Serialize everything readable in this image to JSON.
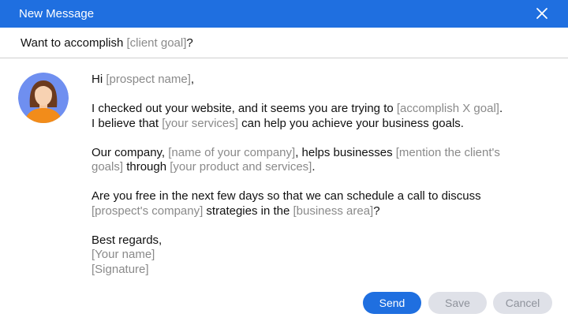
{
  "window": {
    "title": "New Message",
    "close_icon": "close-icon"
  },
  "subject": {
    "prefix": "Want to accomplish ",
    "placeholder": "[client goal]",
    "suffix": "?"
  },
  "avatar": {
    "icon": "user-avatar-icon"
  },
  "message": {
    "greeting": {
      "t1": "Hi ",
      "p1": "[prospect name]",
      "t2": ","
    },
    "para1": {
      "t1": "I checked out your website, and it seems you are trying to ",
      "p1": "[accomplish X goal]",
      "t2": ".\nI believe that ",
      "p2": "[your services]",
      "t3": " can help you achieve your business goals."
    },
    "para2": {
      "t1": "Our company, ",
      "p1": "[name of your company]",
      "t2": ", helps businesses ",
      "p2": "[mention the client's\ngoals]",
      "t3": " through ",
      "p3": "[your product and services]",
      "t4": "."
    },
    "para3": {
      "t1": "Are you free in the next few days so that we can schedule a call to discuss\n",
      "p1": "[prospect's company]",
      "t2": " strategies in the ",
      "p2": "[business area]",
      "t3": "?"
    },
    "signoff": {
      "t1": "Best regards,\n",
      "p1": "[Your name]",
      "t2": "\n",
      "p2": "[Signature]"
    }
  },
  "buttons": {
    "send": "Send",
    "save": "Save",
    "cancel": "Cancel"
  },
  "colors": {
    "accent": "#1f6fe0",
    "placeholder": "#8a8a8a",
    "disabled_button": "#dfe1e8",
    "avatar_bg": "#6f8ff0",
    "avatar_shirt": "#f28c1a",
    "avatar_hair": "#6b3a1e"
  }
}
